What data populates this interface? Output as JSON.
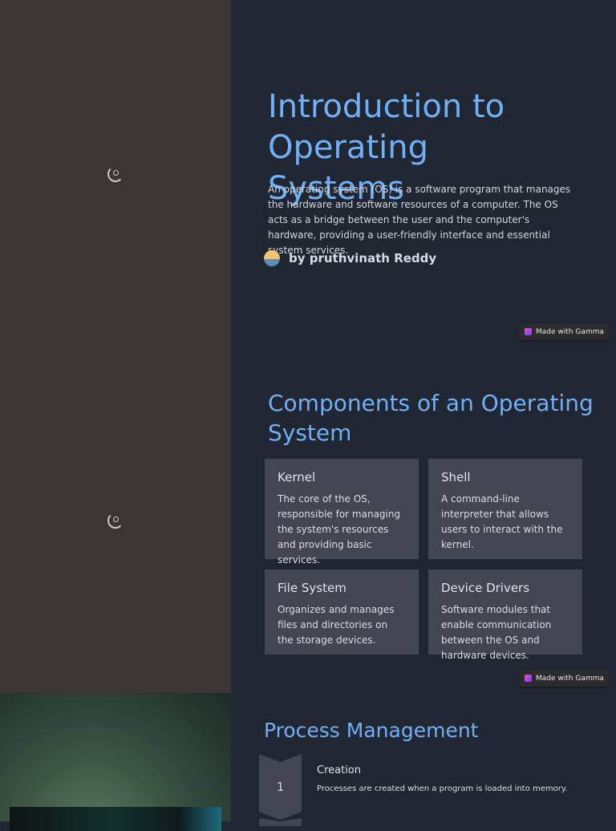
{
  "slide1": {
    "title": "Introduction to Operating Systems",
    "description": "An operating system (OS) is a software program that manages the hardware and software resources of a computer. The OS acts as a bridge between the user and the computer's hardware, providing a user-friendly interface and essential system services.",
    "author": "by pruthvinath Reddy",
    "badge": "Made with Gamma"
  },
  "slide2": {
    "title": "Components of an Operating System",
    "cards": [
      {
        "title": "Kernel",
        "text": "The core of the OS, responsible for managing the system's resources and providing basic services."
      },
      {
        "title": "Shell",
        "text": "A command-line interpreter that allows users to interact with the kernel."
      },
      {
        "title": "File System",
        "text": "Organizes and manages files and directories on the storage devices."
      },
      {
        "title": "Device Drivers",
        "text": "Software modules that enable communication between the OS and hardware devices."
      }
    ],
    "badge": "Made with Gamma"
  },
  "slide3": {
    "title": "Process Management",
    "steps": [
      {
        "number": "1",
        "title": "Creation",
        "text": "Processes are created when a program is loaded into memory."
      }
    ]
  }
}
